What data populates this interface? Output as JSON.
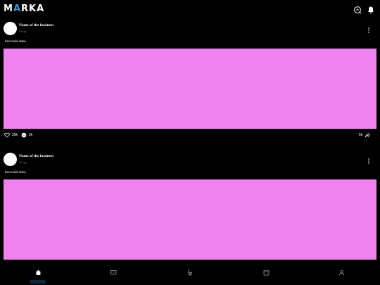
{
  "app": {
    "logo_prefix": "M",
    "logo_accent": "A",
    "logo_suffix": "RKA"
  },
  "posts": [
    {
      "business_name": "Name of the business",
      "time": "1h ago",
      "caption": "best nails done",
      "likes": "20k",
      "comments": "2k",
      "shares": "5k",
      "media_color": "#ee82ee"
    },
    {
      "business_name": "Name of the business",
      "time": "1h ago",
      "caption": "best nails done",
      "media_color": "#ee82ee"
    }
  ],
  "icons": {
    "top": [
      "search-icon",
      "bell-icon"
    ],
    "post": [
      "more-vertical-icon",
      "heart-icon",
      "comment-icon",
      "share-icon"
    ],
    "nav": [
      "home-icon",
      "ticket-icon",
      "salon-chair-icon",
      "calendar-icon",
      "profile-icon"
    ]
  },
  "colors": {
    "background": "#000000",
    "accent": "#4d8fd6",
    "media": "#ee82ee",
    "nav_indicator": "#0f2a3f"
  }
}
